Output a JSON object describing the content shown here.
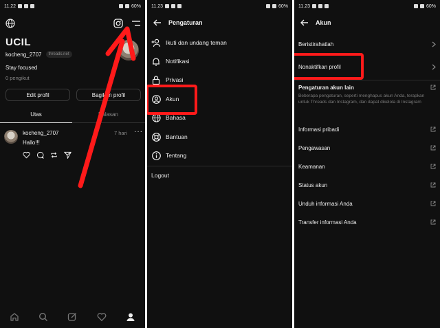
{
  "panels": {
    "profile": {
      "status": {
        "time": "11.22",
        "battery": "60%"
      },
      "username_title": "UCIL",
      "handle": "kocheng_2707",
      "handle_badge": "threads.net",
      "bio": "Stay focused",
      "followers": "0 pengikut",
      "edit_button": "Edit profil",
      "share_button": "Bagikan profil",
      "tabs": [
        "Utas",
        "Balasan"
      ],
      "post": {
        "author": "kocheng_2707",
        "time": "7 hari",
        "text": "Hallo!!!"
      }
    },
    "settings": {
      "status": {
        "time": "11.23",
        "battery": "60%"
      },
      "title": "Pengaturan",
      "items": [
        {
          "label": "Ikuti dan undang teman",
          "icon": "add-person-icon"
        },
        {
          "label": "Notifikasi",
          "icon": "bell-icon"
        },
        {
          "label": "Privasi",
          "icon": "lock-icon"
        },
        {
          "label": "Akun",
          "icon": "account-circle-icon"
        },
        {
          "label": "Bahasa",
          "icon": "globe-icon"
        },
        {
          "label": "Bantuan",
          "icon": "lifebuoy-icon"
        },
        {
          "label": "Tentang",
          "icon": "info-icon"
        }
      ],
      "logout": "Logout"
    },
    "account": {
      "status": {
        "time": "11.23",
        "battery": "60%"
      },
      "title": "Akun",
      "items_top": [
        "Beristirahatlah",
        "Nonaktifkan profil"
      ],
      "other_title": "Pengaturan akun lain",
      "other_desc": "Beberapa pengaturan, seperti menghapus akun Anda, terapkan untuk Threads dan Instagram, dan dapat dikelola di Instagram",
      "items_external": [
        "Informasi pribadi",
        "Pengawasan",
        "Keamanan",
        "Status akun",
        "Unduh informasi Anda",
        "Transfer informasi Anda"
      ]
    }
  },
  "colors": {
    "highlight": "#ff1a1a",
    "background": "#101010"
  }
}
